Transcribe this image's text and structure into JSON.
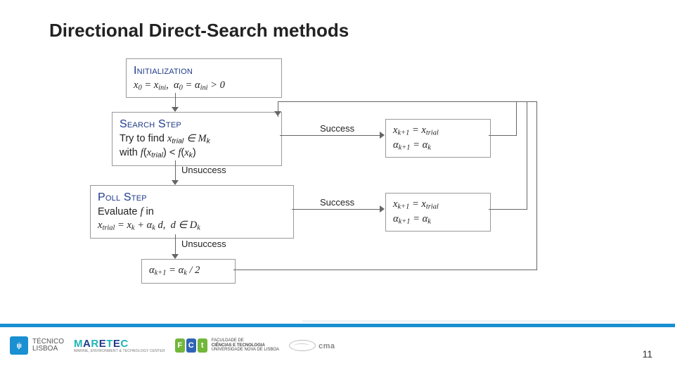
{
  "title": "Directional Direct-Search methods",
  "page_number": "11",
  "annotations": {
    "unsuccess1": "Unsuccess",
    "unsuccess2": "Unsuccess",
    "success1": "Success",
    "success2": "Success"
  },
  "boxes": {
    "init_caps": "Initialization",
    "init_body": "x₀ = x_ini ,  α₀ = α_ini > 0",
    "search_caps": "Search Step",
    "search_body1": "Try to find  x_trial ∈ M_k",
    "search_body2": "with  f(x_trial) < f(x_k)",
    "poll_caps": "Poll Step",
    "poll_body1": "Evaluate  f  in",
    "poll_body2": "x_trial = x_k + α_k d ,  d ∈ D_k",
    "halve": "α_{k+1} = α_k / 2",
    "succ_update1": "x_{k+1} = x_trial",
    "succ_update1b": "α_{k+1} = α_k",
    "succ_update2": "x_{k+1} = x_trial",
    "succ_update2b": "α_{k+1} = α_k"
  },
  "logos": {
    "tecnico1": "TÉCNICO",
    "tecnico2": "LISBOA",
    "maretec": "MARETEC",
    "maretec_sub": "MARINE, ENVIRONMENT & TECHNOLOGY CENTER",
    "fct_line1": "FACULDADE DE",
    "fct_line2": "CIÊNCIAS E TECNOLOGIA",
    "fct_line3": "UNIVERSIDADE NOVA DE LISBOA",
    "cma": "cma"
  }
}
